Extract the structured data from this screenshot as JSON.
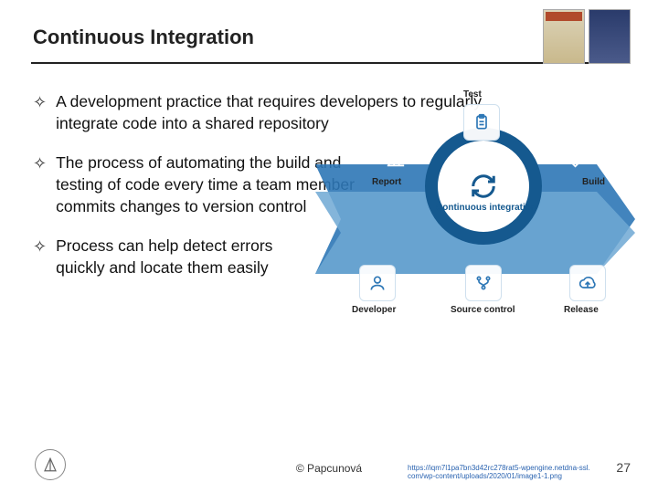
{
  "header": {
    "title": "Continuous Integration"
  },
  "bullets": [
    "A development practice that requires developers to regularly integrate code into a shared repository",
    "The process of automating the build and testing of code every time a team member commits changes to version control",
    "Process can help detect errors quickly and locate them easily"
  ],
  "diagram": {
    "center_label": "Continuous integration",
    "labels": {
      "test": "Test",
      "report": "Report",
      "build": "Build",
      "developer": "Developer",
      "source_control": "Source control",
      "release": "Release"
    }
  },
  "footer": {
    "copyright": "© Papcunová",
    "source_url": "https://iqm7l1pa7bn3d42rc278rat5-wpengine.netdna-ssl.com/wp-content/uploads/2020/01/image1-1.png",
    "page_number": "27"
  }
}
